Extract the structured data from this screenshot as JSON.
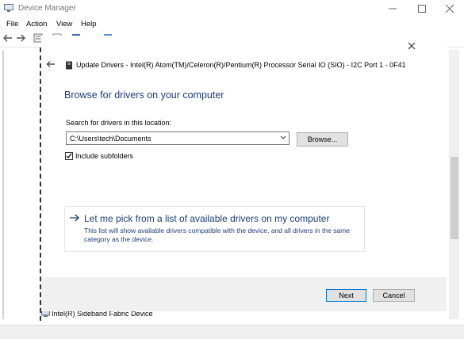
{
  "window": {
    "title": "Device Manager",
    "minimize_icon": "minimize-icon",
    "maximize_icon": "maximize-icon",
    "close_icon": "close-icon"
  },
  "menu": {
    "file": "File",
    "action": "Action",
    "view": "View",
    "help": "Help"
  },
  "tree": {
    "visible_item": "Intel(R) Sideband Fabric Device"
  },
  "dialog": {
    "title": "Update Drivers - Intel(R) Atom(TM)/Celeron(R)/Pentium(R) Processor Serial IO (SIO) - I2C Port 1 - 0F41",
    "heading": "Browse for drivers on your computer",
    "search_label": "Search for drivers in this location:",
    "search_path": "C:\\Users\\tech\\Documents",
    "browse_label": "Browse...",
    "include_subfolders_label": "Include subfolders",
    "include_subfolders_checked": true,
    "pick_link": "Let me pick from a list of available drivers on my computer",
    "pick_description": "This list will show available drivers compatible with the device, and all drivers in the same category as the device.",
    "next_label": "Next",
    "cancel_label": "Cancel"
  },
  "colors": {
    "heading_blue": "#1c3d7a",
    "footer_bg": "#f0f0f0",
    "button_bg": "#e1e1e1",
    "focus_border": "#0078d7"
  }
}
